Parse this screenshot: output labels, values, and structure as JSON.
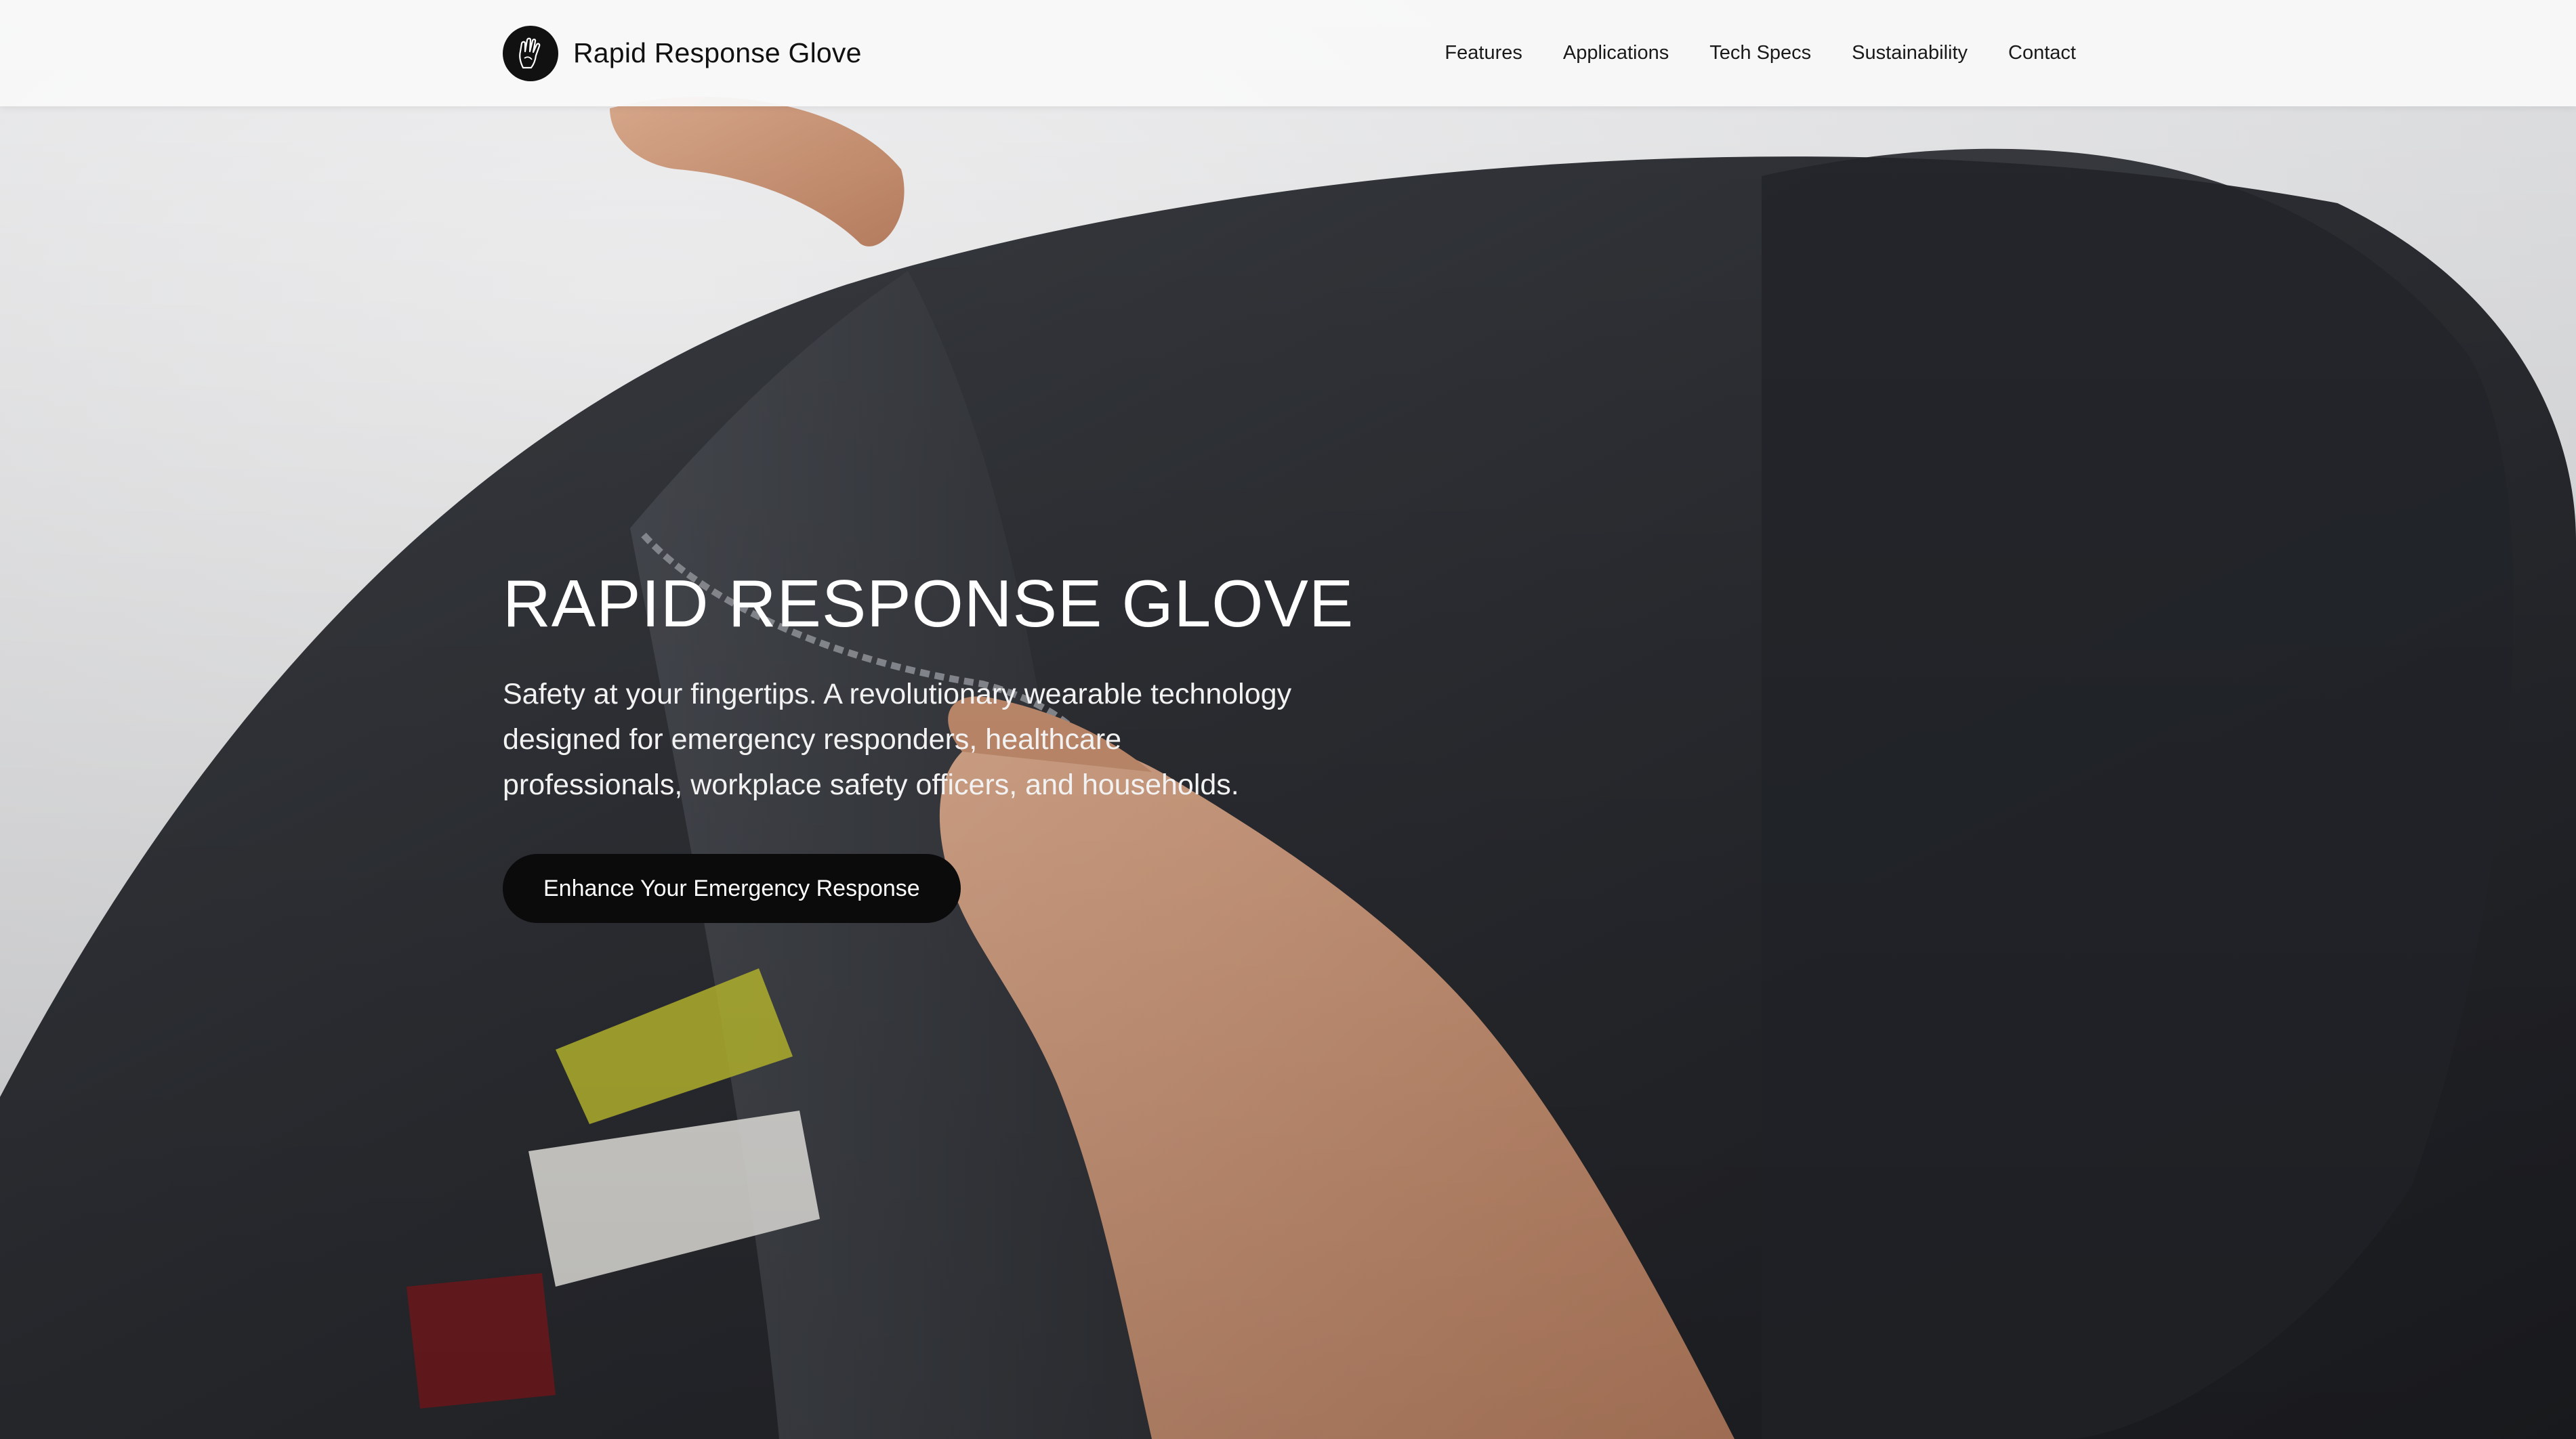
{
  "header": {
    "brand_name": "Rapid Response Glove",
    "logo_icon": "hand-glove-icon",
    "nav": [
      {
        "label": "Features"
      },
      {
        "label": "Applications"
      },
      {
        "label": "Tech Specs"
      },
      {
        "label": "Sustainability"
      },
      {
        "label": "Contact"
      }
    ]
  },
  "hero": {
    "title": "RAPID RESPONSE GLOVE",
    "subtitle": "Safety at your fingertips. A revolutionary wearable technology designed for emergency responders, healthcare professionals, workplace safety officers, and households.",
    "cta_label": "Enhance Your Emergency Response"
  },
  "colors": {
    "header_bg": "#f8f8f8",
    "cta_bg": "#0b0b0c",
    "hero_text": "#ffffff",
    "background_fabric": "#2a2c30"
  }
}
